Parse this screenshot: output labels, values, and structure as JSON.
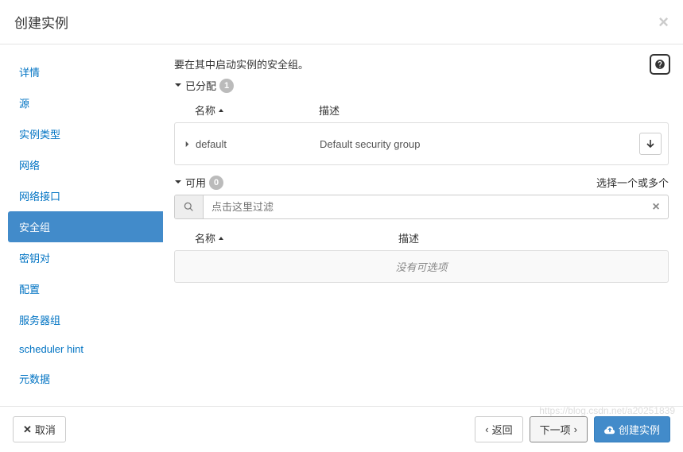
{
  "header": {
    "title": "创建实例"
  },
  "sidebar": {
    "items": [
      {
        "label": "详情"
      },
      {
        "label": "源"
      },
      {
        "label": "实例类型"
      },
      {
        "label": "网络"
      },
      {
        "label": "网络接口"
      },
      {
        "label": "安全组"
      },
      {
        "label": "密钥对"
      },
      {
        "label": "配置"
      },
      {
        "label": "服务器组"
      },
      {
        "label": "scheduler hint"
      },
      {
        "label": "元数据"
      }
    ]
  },
  "content": {
    "description": "要在其中启动实例的安全组。",
    "allocated": {
      "label": "已分配",
      "count": "1",
      "columns": {
        "name": "名称",
        "desc": "描述"
      },
      "items": [
        {
          "name": "default",
          "desc": "Default security group"
        }
      ]
    },
    "available": {
      "label": "可用",
      "count": "0",
      "hint": "选择一个或多个",
      "filter_placeholder": "点击这里过滤",
      "columns": {
        "name": "名称",
        "desc": "描述"
      },
      "empty": "没有可选项"
    }
  },
  "footer": {
    "cancel": "取消",
    "back": "返回",
    "next": "下一项",
    "launch": "创建实例"
  },
  "watermark": "https://blog.csdn.net/a20251839"
}
